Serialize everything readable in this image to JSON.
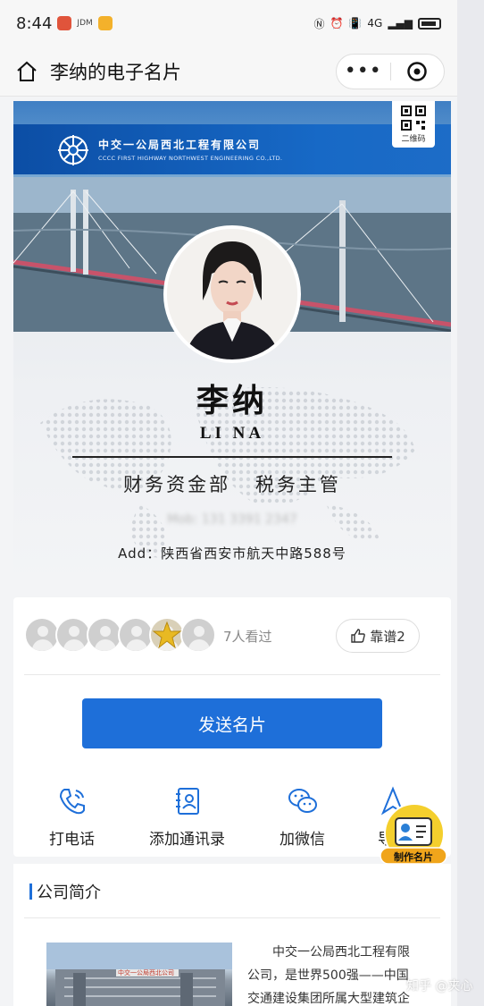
{
  "status_bar": {
    "time": "8:44",
    "notif_label": "JDM",
    "network": "4G"
  },
  "nav": {
    "title": "李纳的电子名片",
    "more": "•••"
  },
  "card": {
    "company_cn": "中交一公局西北工程有限公司",
    "company_en": "CCCC FIRST HIGHWAY NORTHWEST ENGINEERING CO.,LTD.",
    "qr_label": "二维码",
    "name_cn": "李纳",
    "name_en": "LI NA",
    "department": "财务资金部",
    "position": "税务主管",
    "mobile": "Mob: 131 3391 2347",
    "address": "Add：陕西省西安市航天中路588号"
  },
  "stats": {
    "views": "7人看过",
    "like_label": "靠谱2"
  },
  "send_button": "发送名片",
  "actions": [
    {
      "label": "打电话",
      "icon": "phone-icon"
    },
    {
      "label": "添加通讯录",
      "icon": "contacts-icon"
    },
    {
      "label": "加微信",
      "icon": "wechat-icon"
    },
    {
      "label": "导航",
      "icon": "navigation-icon"
    }
  ],
  "make_card": "制作名片",
  "intro": {
    "title": "公司简介",
    "text": "中交一公局西北工程有限公司，是世界500强——中国交通建设集团所属大型建筑企",
    "photo_sign": "中交一公局西北公司"
  },
  "watermark": "知乎 @夹心",
  "colors": {
    "primary": "#1e6fd9",
    "banner_blue": "#0c4ea5"
  }
}
